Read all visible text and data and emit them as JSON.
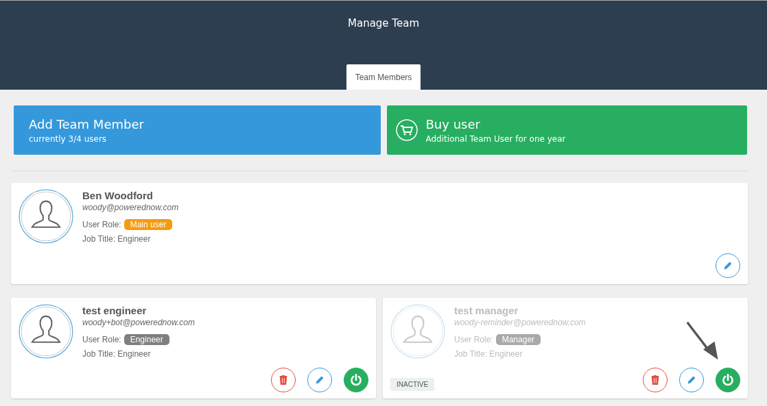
{
  "header": {
    "title": "Manage Team"
  },
  "tabs": [
    {
      "label": "Team Members",
      "selected": true
    }
  ],
  "actions": [
    {
      "kind": "add",
      "title": "Add Team Member",
      "subtitle": "currently 3/4 users"
    },
    {
      "kind": "buy",
      "title": "Buy user",
      "subtitle": "Additional Team User for one year"
    }
  ],
  "members": [
    {
      "name": "Ben Woodford",
      "email": "woody@powerednow.com",
      "role_label": "User Role:",
      "role": "Main user",
      "color": "#f39c12",
      "job": "Job Title: Engineer",
      "active": true,
      "wide": true,
      "buttons": [
        {
          "kind": "edit"
        }
      ]
    },
    {
      "name": "test engineer",
      "email": "woody+bot@powerednow.com",
      "role_label": "User Role:",
      "role": "Engineer",
      "color": "#7f7f7f",
      "job": "Job Title: Engineer",
      "active": true,
      "wide": false,
      "buttons": [
        {
          "kind": "delete"
        },
        {
          "kind": "edit"
        },
        {
          "kind": "power"
        }
      ]
    },
    {
      "name": "test manager",
      "email": "woody-reminder@powerednow.com",
      "role_label": "User Role:",
      "role": "Manager",
      "color": "#a9a9a9",
      "job": "Job Title: Engineer",
      "active": false,
      "status_badge": "INACTIVE",
      "wide": false,
      "buttons": [
        {
          "kind": "delete"
        },
        {
          "kind": "edit"
        },
        {
          "kind": "power"
        }
      ],
      "pointer_arrow": true
    }
  ]
}
